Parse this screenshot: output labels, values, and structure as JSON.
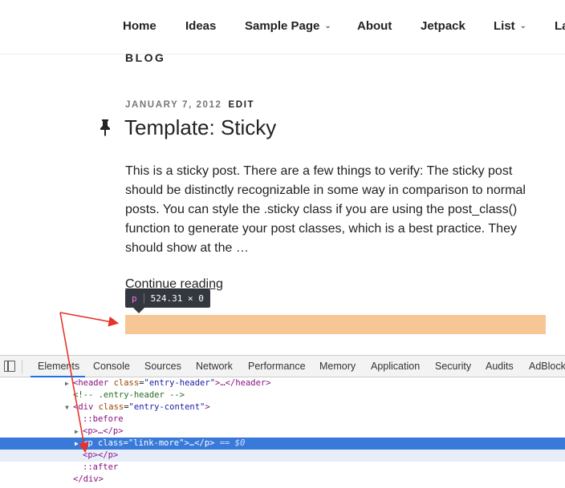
{
  "nav": {
    "items": [
      {
        "label": "Home",
        "has_dropdown": false
      },
      {
        "label": "Ideas",
        "has_dropdown": false
      },
      {
        "label": "Sample Page",
        "has_dropdown": true
      },
      {
        "label": "About",
        "has_dropdown": false
      },
      {
        "label": "Jetpack",
        "has_dropdown": false
      },
      {
        "label": "List",
        "has_dropdown": true
      },
      {
        "label": "La",
        "has_dropdown": false
      }
    ]
  },
  "page": {
    "section_label": "BLOG",
    "post": {
      "date": "JANUARY 7, 2012",
      "edit_label": "EDIT",
      "title": "Template: Sticky",
      "excerpt": "This is a sticky post. There are a few things to verify: The sticky post should be distinctly recognizable in some way in comparison to normal posts. You can style the .sticky class if you are using the post_class() function to generate your post classes, which is a best practice. They should show at the …",
      "continue_label": "Continue reading",
      "pin_icon": "pushpin-icon"
    }
  },
  "inspector_tooltip": {
    "tag": "p",
    "dimensions": "524.31 × 0"
  },
  "devtools": {
    "tabs": [
      "Elements",
      "Console",
      "Sources",
      "Network",
      "Performance",
      "Memory",
      "Application",
      "Security",
      "Audits",
      "AdBlock"
    ],
    "active_tab": "Elements",
    "dom": {
      "row0": {
        "tag_open": "<header ",
        "attr": "class",
        "val": "\"entry-header\"",
        "rest": ">…</header>"
      },
      "row1": {
        "comment": "<!-- .entry-header -->"
      },
      "row2": {
        "tag_open": "<div ",
        "attr": "class",
        "val": "\"entry-content\"",
        "rest": ">"
      },
      "row3": {
        "pseudo": "::before"
      },
      "row4": {
        "text": "<p>…</p>"
      },
      "row5": {
        "tag_open": "<p ",
        "attr": "class",
        "val": "\"link-more\"",
        "rest": ">…</p>",
        "eq": " == $0"
      },
      "row6": {
        "text": "<p></p>"
      },
      "row7": {
        "pseudo": "::after"
      },
      "row8": {
        "text": "</div>"
      }
    }
  },
  "colors": {
    "highlight": "#f6c795",
    "selected_row": "#3879d9",
    "annotation_arrow": "#e8332a",
    "tab_underline": "#1a73e8"
  }
}
